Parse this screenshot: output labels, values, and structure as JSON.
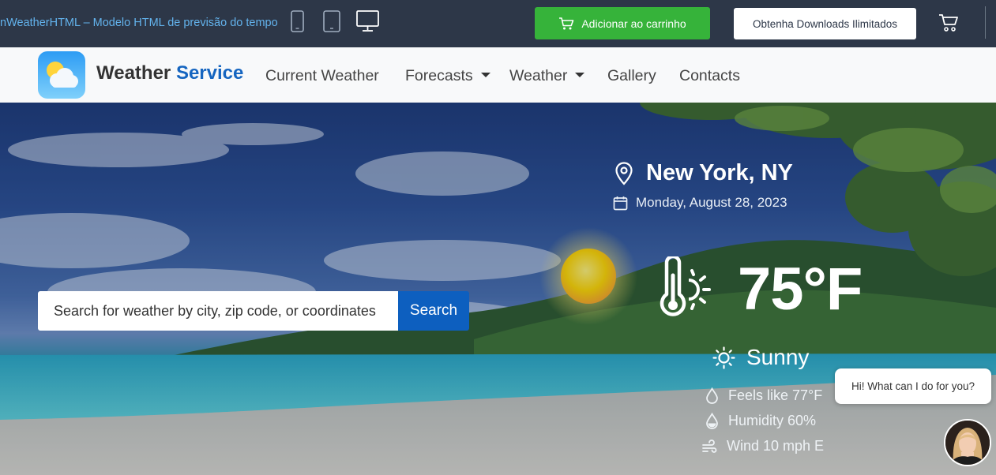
{
  "topbar": {
    "template_title": "nWeatherHTML – Modelo HTML de previsão do tempo",
    "cart_button": "Adicionar ao carrinho",
    "downloads_button": "Obtenha Downloads Ilimitados",
    "devices": [
      "mobile-icon",
      "tablet-icon",
      "desktop-icon"
    ]
  },
  "navbar": {
    "brand_main": "Weather",
    "brand_accent": "Service",
    "items": [
      {
        "label": "Current Weather"
      },
      {
        "label": "Forecasts"
      },
      {
        "label": "Weather"
      },
      {
        "label": "Gallery"
      },
      {
        "label": "Contacts"
      }
    ]
  },
  "search": {
    "placeholder": "Search for weather by city, zip code, or coordinates",
    "button": "Search"
  },
  "weather": {
    "location": "New York, NY",
    "date": "Monday, August 28, 2023",
    "temperature": "75°F",
    "condition": "Sunny",
    "feels_like": "Feels like 77°F",
    "humidity": "Humidity 60%",
    "wind": "Wind 10 mph E"
  },
  "chat": {
    "bubble": "Hi! What can I do for you?"
  },
  "colors": {
    "topbar_bg": "#2d3748",
    "cart_green": "#36b33a",
    "brand_accent": "#1565c0",
    "search_button": "#0d5fbf"
  }
}
